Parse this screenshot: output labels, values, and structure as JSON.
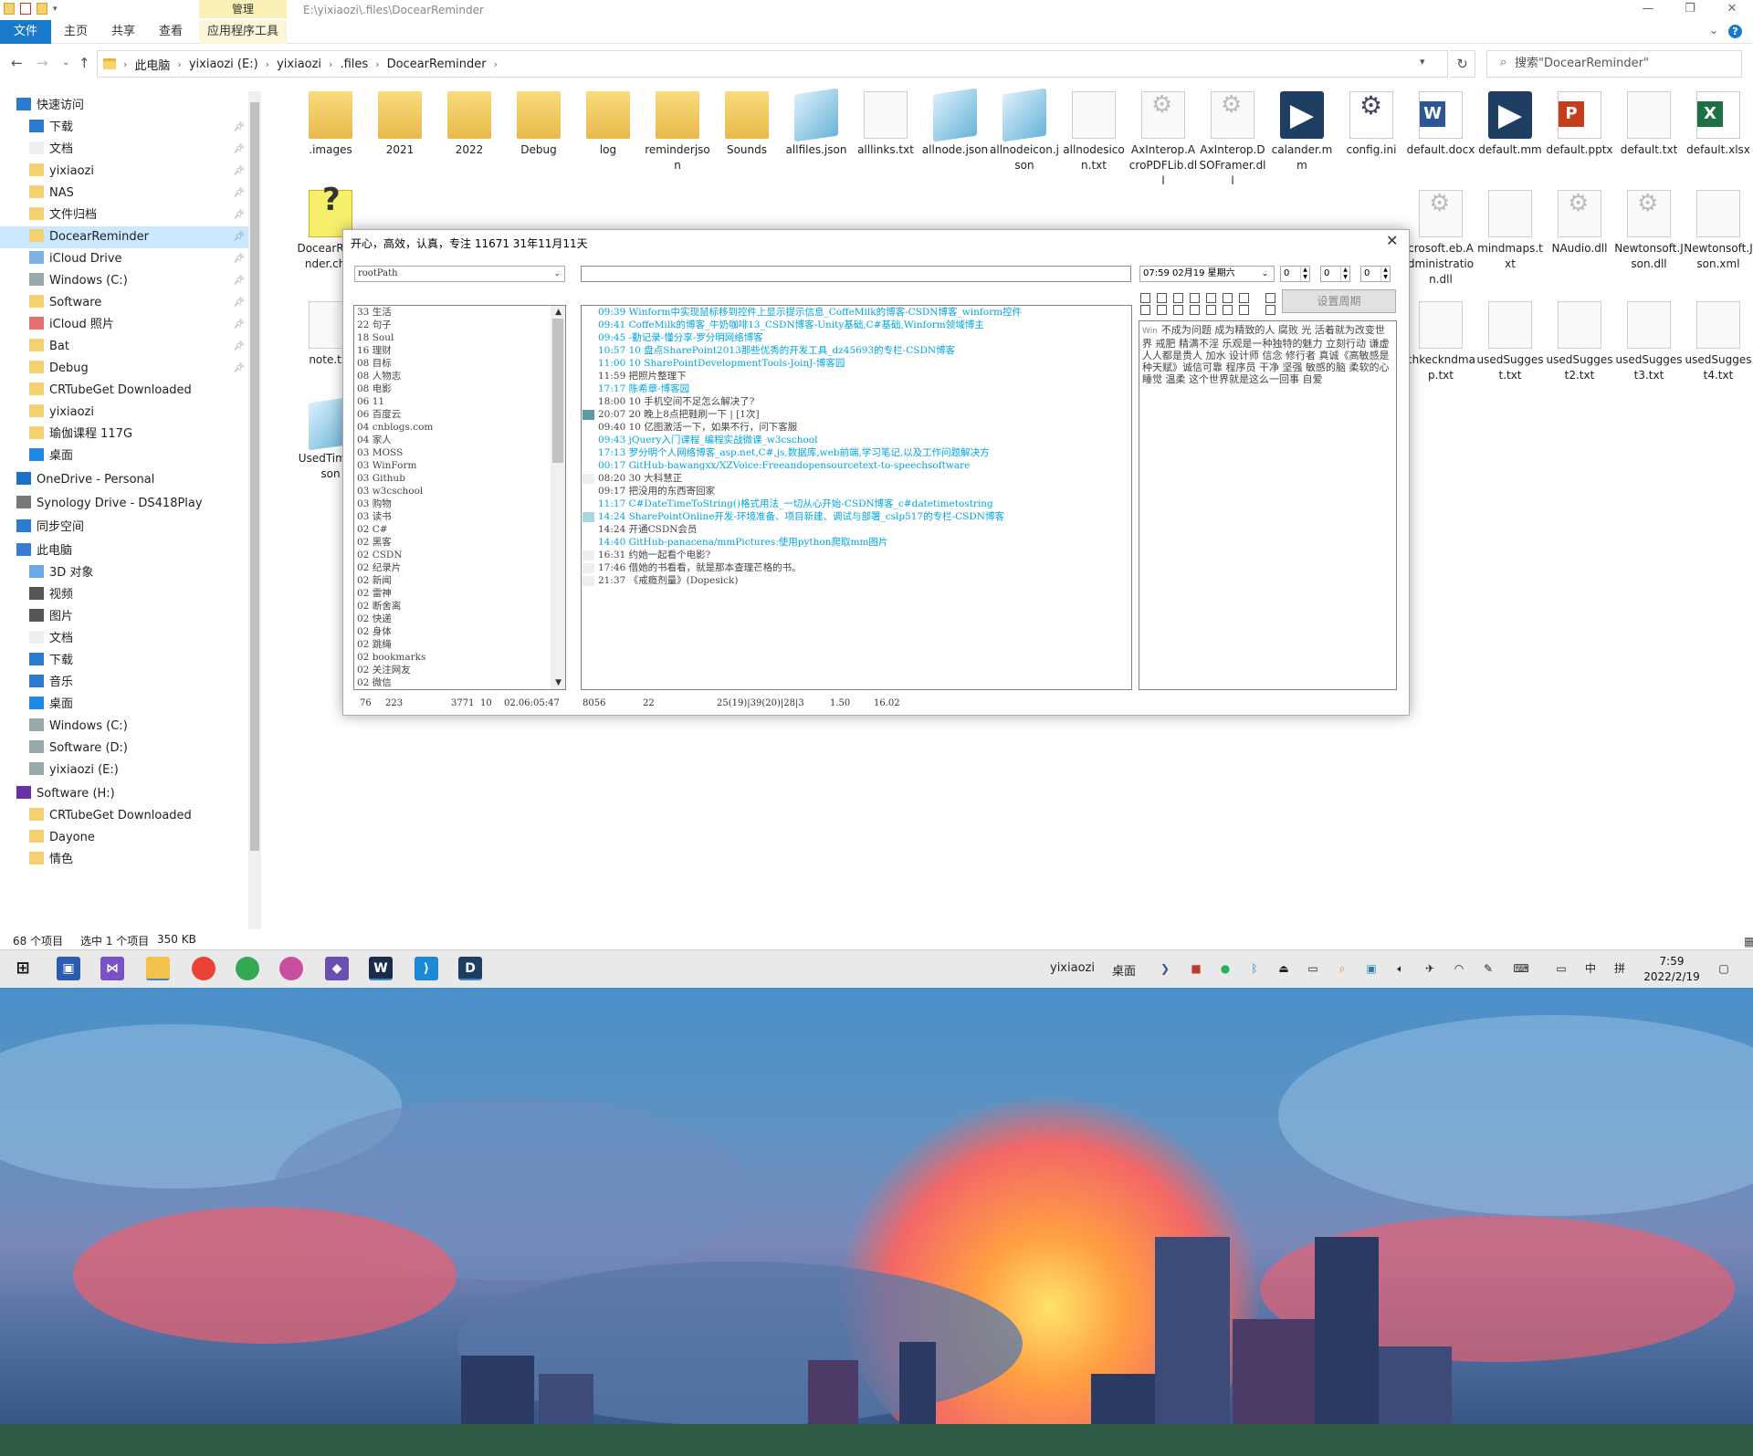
{
  "window": {
    "manage_tab": "管理",
    "path_title": "E:\\yixiaozi\\.files\\DocearReminder",
    "controls": [
      "—",
      "❐",
      "✕"
    ]
  },
  "ribbon": {
    "file": "文件",
    "home": "主页",
    "share": "共享",
    "view": "查看",
    "app_tools": "应用程序工具",
    "help": "?"
  },
  "address": {
    "crumbs": [
      "此电脑",
      "yixiaozi (E:)",
      "yixiaozi",
      ".files",
      "DocearReminder"
    ],
    "search_placeholder": "搜索\"DocearReminder\""
  },
  "nav": {
    "items": [
      {
        "label": "快速访问",
        "icon": "star-icon",
        "pinned": false
      },
      {
        "label": "下载",
        "icon": "download-icon",
        "pinned": true
      },
      {
        "label": "文档",
        "icon": "document-icon",
        "pinned": true
      },
      {
        "label": "yixiaozi",
        "icon": "folder-icon",
        "pinned": true
      },
      {
        "label": "NAS",
        "icon": "folder-icon",
        "pinned": true
      },
      {
        "label": "文件归档",
        "icon": "folder-icon",
        "pinned": true
      },
      {
        "label": "DocearReminder",
        "icon": "folder-icon",
        "pinned": true,
        "selected": true
      },
      {
        "label": "iCloud Drive",
        "icon": "cloud-icon",
        "pinned": true
      },
      {
        "label": "Windows (C:)",
        "icon": "drive-icon",
        "pinned": true
      },
      {
        "label": "Software",
        "icon": "folder-icon",
        "pinned": true
      },
      {
        "label": "iCloud 照片",
        "icon": "photos-icon",
        "pinned": true
      },
      {
        "label": "Bat",
        "icon": "folder-icon",
        "pinned": true
      },
      {
        "label": "Debug",
        "icon": "folder-icon",
        "pinned": true
      },
      {
        "label": "CRTubeGet Downloaded",
        "icon": "folder-icon",
        "pinned": false
      },
      {
        "label": "yixiaozi",
        "icon": "folder-icon",
        "pinned": false
      },
      {
        "label": "瑜伽课程 117G",
        "icon": "folder-icon",
        "pinned": false
      },
      {
        "label": "桌面",
        "icon": "desktop-icon",
        "pinned": false
      },
      {
        "label": "OneDrive - Personal",
        "icon": "onedrive-icon",
        "pinned": false
      },
      {
        "label": "Synology Drive - DS418Play",
        "icon": "synology-icon",
        "pinned": false
      },
      {
        "label": "同步空间",
        "icon": "sync-icon",
        "pinned": false
      },
      {
        "label": "此电脑",
        "icon": "computer-icon",
        "pinned": false
      },
      {
        "label": "3D 对象",
        "icon": "cube-icon",
        "pinned": false
      },
      {
        "label": "视频",
        "icon": "video-icon",
        "pinned": false
      },
      {
        "label": "图片",
        "icon": "picture-icon",
        "pinned": false
      },
      {
        "label": "文档",
        "icon": "document-icon",
        "pinned": false
      },
      {
        "label": "下载",
        "icon": "download-icon",
        "pinned": false
      },
      {
        "label": "音乐",
        "icon": "music-icon",
        "pinned": false
      },
      {
        "label": "桌面",
        "icon": "desktop-icon",
        "pinned": false
      },
      {
        "label": "Windows (C:)",
        "icon": "drive-icon",
        "pinned": false
      },
      {
        "label": "Software (D:)",
        "icon": "drive-icon",
        "pinned": false
      },
      {
        "label": "yixiaozi (E:)",
        "icon": "drive-icon",
        "pinned": false
      },
      {
        "label": "Software (H:)",
        "icon": "synology-drive-icon",
        "pinned": false
      },
      {
        "label": "Software (H:)",
        "icon": "synology-drive-icon",
        "pinned": false
      },
      {
        "label": "CRTubeGet Downloaded",
        "icon": "folder-icon",
        "pinned": false
      },
      {
        "label": "Dayone",
        "icon": "folder-icon",
        "pinned": false
      },
      {
        "label": "情色",
        "icon": "folder-icon",
        "pinned": false
      }
    ]
  },
  "files": [
    {
      "name": ".images",
      "type": "folder"
    },
    {
      "name": "2021",
      "type": "folder"
    },
    {
      "name": "2022",
      "type": "folder"
    },
    {
      "name": "Debug",
      "type": "folder"
    },
    {
      "name": "log",
      "type": "folder"
    },
    {
      "name": "reminderjson",
      "type": "folder"
    },
    {
      "name": "Sounds",
      "type": "folder"
    },
    {
      "name": "allfiles.json",
      "type": "note"
    },
    {
      "name": "alllinks.txt",
      "type": "doc"
    },
    {
      "name": "allnode.json",
      "type": "note"
    },
    {
      "name": "allnodeicon.json",
      "type": "note"
    },
    {
      "name": "allnodesicon.txt",
      "type": "doc"
    },
    {
      "name": "AxInterop.AcroPDFLib.dll",
      "type": "gear"
    },
    {
      "name": "AxInterop.DSOFramer.dll",
      "type": "gear"
    },
    {
      "name": "calander.mm",
      "type": "docear"
    },
    {
      "name": "config.ini",
      "type": "cfg"
    },
    {
      "name": "default.docx",
      "type": "word"
    },
    {
      "name": "default.mm",
      "type": "docear"
    },
    {
      "name": "default.pptx",
      "type": "ppt"
    },
    {
      "name": "default.txt",
      "type": "doc"
    },
    {
      "name": "default.xlsx",
      "type": "xls"
    },
    {
      "name": "DocearReminder.chm",
      "type": "help"
    },
    {
      "name": "crosoft.eb.Administration.dll",
      "type": "gear"
    },
    {
      "name": "mindmaps.txt",
      "type": "doc"
    },
    {
      "name": "NAudio.dll",
      "type": "gear"
    },
    {
      "name": "Newtonsoft.Json.dll",
      "type": "gear"
    },
    {
      "name": "Newtonsoft.Json.xml",
      "type": "doc"
    },
    {
      "name": "note.txt",
      "type": "doc"
    },
    {
      "name": "chkeckndmap.txt",
      "type": "doc"
    },
    {
      "name": "usedSuggest.txt",
      "type": "doc"
    },
    {
      "name": "usedSuggest2.txt",
      "type": "doc"
    },
    {
      "name": "usedSuggest3.txt",
      "type": "doc"
    },
    {
      "name": "usedSuggest4.txt",
      "type": "doc"
    },
    {
      "name": "UsedTimer.json",
      "type": "note"
    }
  ],
  "status": {
    "count": "68 个项目",
    "selected": "选中 1 个项目",
    "size": "350 KB"
  },
  "taskbar": {
    "user": "yixiaozi",
    "desktop": "桌面",
    "ime1": "中",
    "ime2": "拼",
    "time": "7:59",
    "date": "2022/2/19"
  },
  "popup": {
    "title": "开心，高效，认真，专注   11671   31年11月11天",
    "rootpath": "rootPath",
    "datetime": "07:59 02月19 星期六",
    "spin1": "0",
    "spin2": "0",
    "spin3": "0",
    "set_period": "设置周期",
    "left_list": [
      "33 生活",
      "22 句子",
      "18 Soul",
      "16 理财",
      "08 目标",
      "08 人物志",
      "08 电影",
      "06 11",
      "06 百度云",
      "04 cnblogs.com",
      "04 家人",
      "03 MOSS",
      "03 WinForm",
      "03 Github",
      "03 w3cschool",
      "03 购物",
      "03 读书",
      "02 C#",
      "02 黑客",
      "02 CSDN",
      "02 纪录片",
      "02 新闻",
      "02 雷神",
      "02 断舍离",
      "02 快递",
      "02 身体",
      "02 跳绳",
      "02 bookmarks",
      "02 关注网友",
      "02 微信"
    ],
    "mid_list": [
      {
        "t": " 09:39    Winform中实现鼠标移到控件上显示提示信息_CoffeMilk的博客-CSDN博客_winform控件",
        "c": "link",
        "m": ""
      },
      {
        "t": " 09:41    CoffeMilk的博客_牛奶咖啡13_CSDN博客-Unity基础,C#基础,Winform领域博主",
        "c": "link",
        "m": ""
      },
      {
        "t": " 09:45    -勤记录-懂分享-罗分明网络博客",
        "c": "link",
        "m": ""
      },
      {
        "t": " 10:57  10 盘点SharePoint2013那些优秀的开发工具_dz45693的专栏-CSDN博客",
        "c": "link",
        "m": ""
      },
      {
        "t": " 11:00 10 SharePointDevelopmentTools-JoinJ-博客园",
        "c": "link",
        "m": ""
      },
      {
        "t": " 11:59     把照片整理下",
        "c": "plain",
        "m": ""
      },
      {
        "t": " 17:17     陈希章-博客园",
        "c": "link",
        "m": ""
      },
      {
        "t": " 18:00  10 手机空间不足怎么解决了?",
        "c": "plain",
        "m": ""
      },
      {
        "t": " 20:07  20 晚上8点把鞋刷一下 | [1次]",
        "c": "plain",
        "m": "#5b9aa0"
      },
      {
        "t": " 09:40  10 亿图激活一下，如果不行，问下客服",
        "c": "plain",
        "m": ""
      },
      {
        "t": " 09:43     jQuery入门课程_编程实战微课_w3cschool",
        "c": "link",
        "m": ""
      },
      {
        "t": " 17:13     罗分明个人网络博客_asp.net,C#,js,数据库,web前端,学习笔记,以及工作问题解决方",
        "c": "link",
        "m": ""
      },
      {
        "t": " 00:17   GitHub-bawangxx/XZVoice:Freeandopensourcetext-to-speechsoftware",
        "c": "link",
        "m": ""
      },
      {
        "t": " 08:20  30 大科慧正",
        "c": "plain",
        "m": "#eeeeee"
      },
      {
        "t": " 09:17     把没用的东西寄回家",
        "c": "plain",
        "m": ""
      },
      {
        "t": " 11:17    C#DateTimeToString()格式用法_一切从心开始-CSDN博客_c#datetimetostring",
        "c": "link",
        "m": ""
      },
      {
        "t": " 14:24    SharePointOnline开发-环境准备、项目新建、调试与部署_cslp517的专栏-CSDN博客",
        "c": "link",
        "m": "#a9d8e0"
      },
      {
        "t": " 14:24     开通CSDN会员",
        "c": "plain",
        "m": ""
      },
      {
        "t": " 14:40    GitHub-panacena/mmPictures:使用python爬取mm图片",
        "c": "link",
        "m": ""
      },
      {
        "t": " 16:31     约她一起看个电影?",
        "c": "plain",
        "m": "#eeeeee"
      },
      {
        "t": " 17:46     借她的书看看，就是那本查理芒格的书。",
        "c": "plain",
        "m": "#eeeeee"
      },
      {
        "t": " 21:37     《戒瘾剂量》(Dopesick)",
        "c": "plain",
        "m": "#eeeeee"
      }
    ],
    "right_small": "Win",
    "right_text": "不成为问题 成为精致的人 腐败 光 活着就为改变世界 戒肥 精满不淫 乐观是一种独特的魅力 立刻行动 谦虚 人人都是贵人 加水 设计师 信念 修行者 真诚《高敏感是种天赋》诚信可靠 程序员 干净 坚强 敏感的脑 柔软的心 睡觉 温柔 这个世界就是这么一回事 自爱",
    "status": [
      "76",
      "223",
      "3771",
      "10",
      "02.06:05:47",
      "8056",
      "22",
      "25(19)|39(20)|28|3",
      "1.50",
      "16.02"
    ]
  }
}
